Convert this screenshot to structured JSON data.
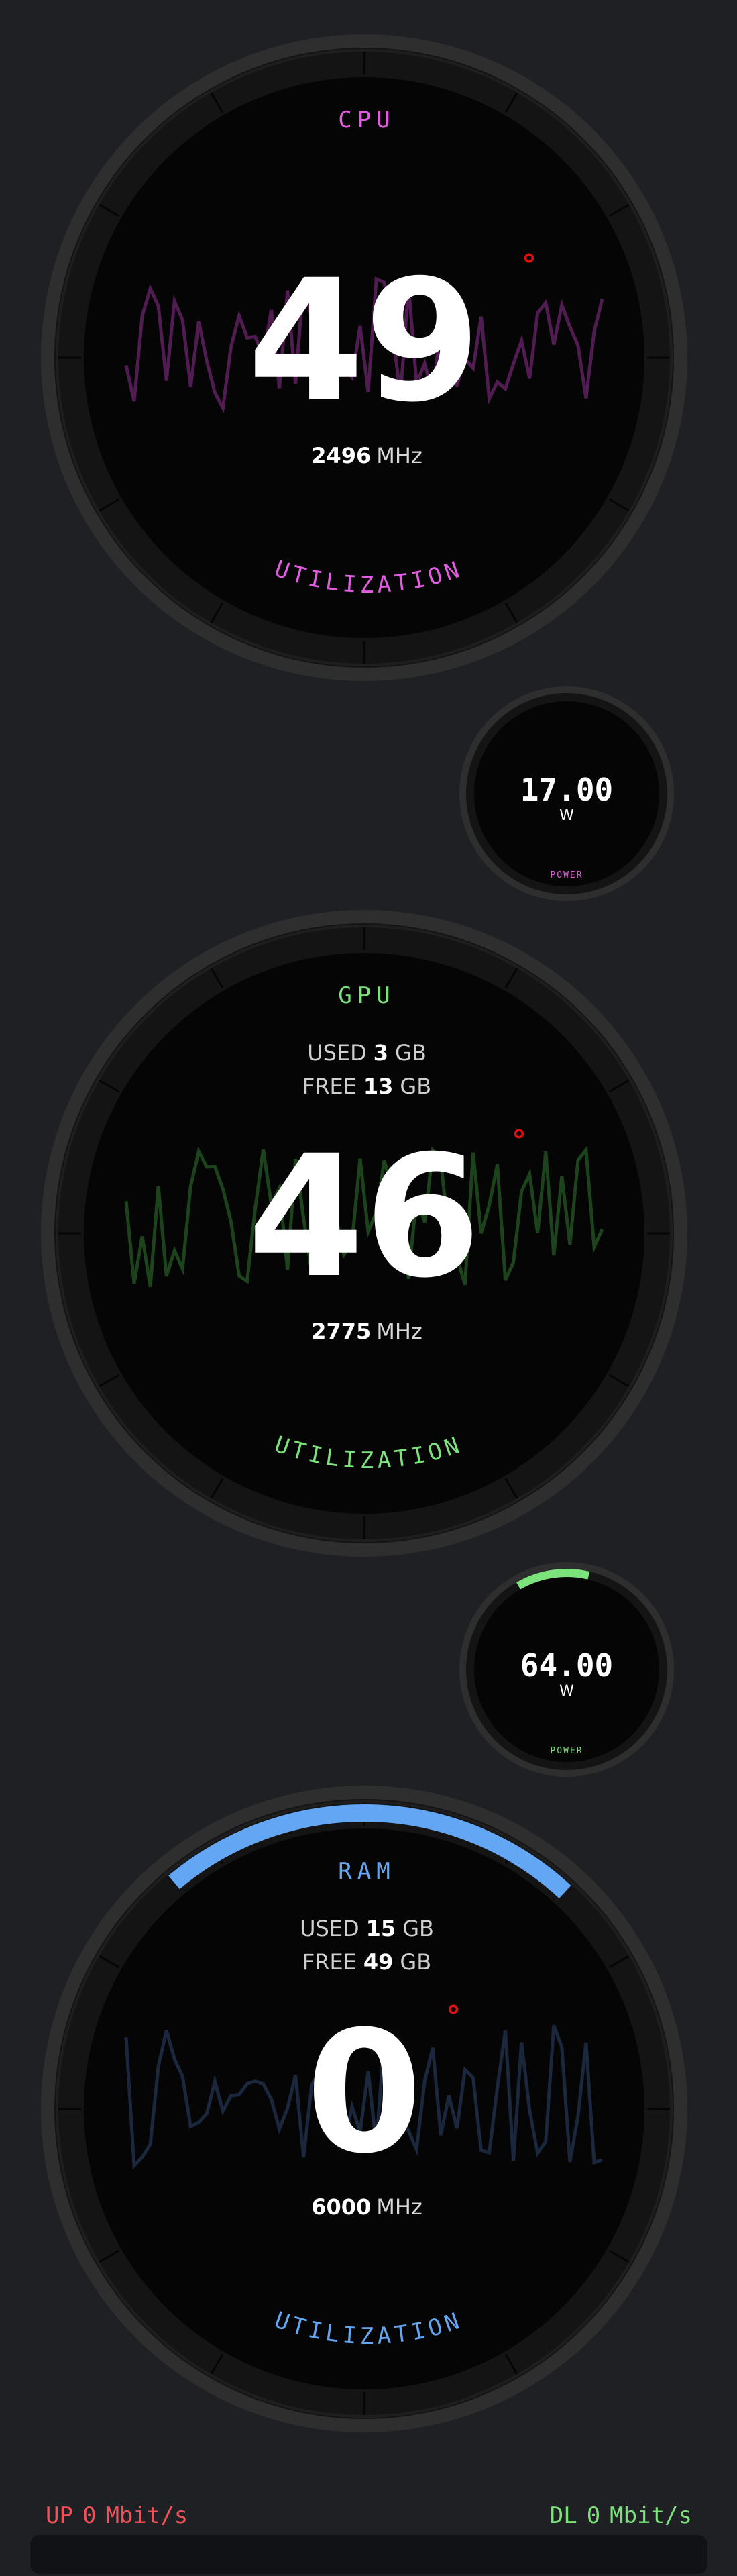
{
  "colors": {
    "background": "#1e2024",
    "gauge_face": "#050505",
    "bezel": "#2e2e2e",
    "cpu_accent": "#e25ce0",
    "gpu_accent": "#7ce27c",
    "ram_accent": "#63a6f3",
    "degree_red": "#e01010",
    "net_up": "#f0525a",
    "net_dl": "#7de27c"
  },
  "cpu": {
    "title": "CPU",
    "value": "49",
    "clock": "2496",
    "clock_unit": "MHz",
    "caption": "UTILIZATION",
    "utilization_fraction": 0.0,
    "power": {
      "value": "17.00",
      "unit": "W",
      "caption": "POWER",
      "level_fraction": 0.0
    }
  },
  "gpu": {
    "title": "GPU",
    "used_label": "USED",
    "used_value": "3",
    "used_unit": "GB",
    "free_label": "FREE",
    "free_value": "13",
    "free_unit": "GB",
    "value": "46",
    "clock": "2775",
    "clock_unit": "MHz",
    "caption": "UTILIZATION",
    "utilization_fraction": 0.0,
    "power": {
      "value": "64.00",
      "unit": "W",
      "caption": "POWER",
      "level_fraction": 0.12
    }
  },
  "ram": {
    "title": "RAM",
    "used_label": "USED",
    "used_value": "15",
    "used_unit": "GB",
    "free_label": "FREE",
    "free_value": "49",
    "free_unit": "GB",
    "value": "0",
    "clock": "6000",
    "clock_unit": "MHz",
    "caption": "UTILIZATION",
    "utilization_fraction": 0.23
  },
  "network": {
    "up_label": "UP",
    "up_value": "0",
    "up_unit": "Mbit/s",
    "dl_label": "DL",
    "dl_value": "0",
    "dl_unit": "Mbit/s"
  }
}
